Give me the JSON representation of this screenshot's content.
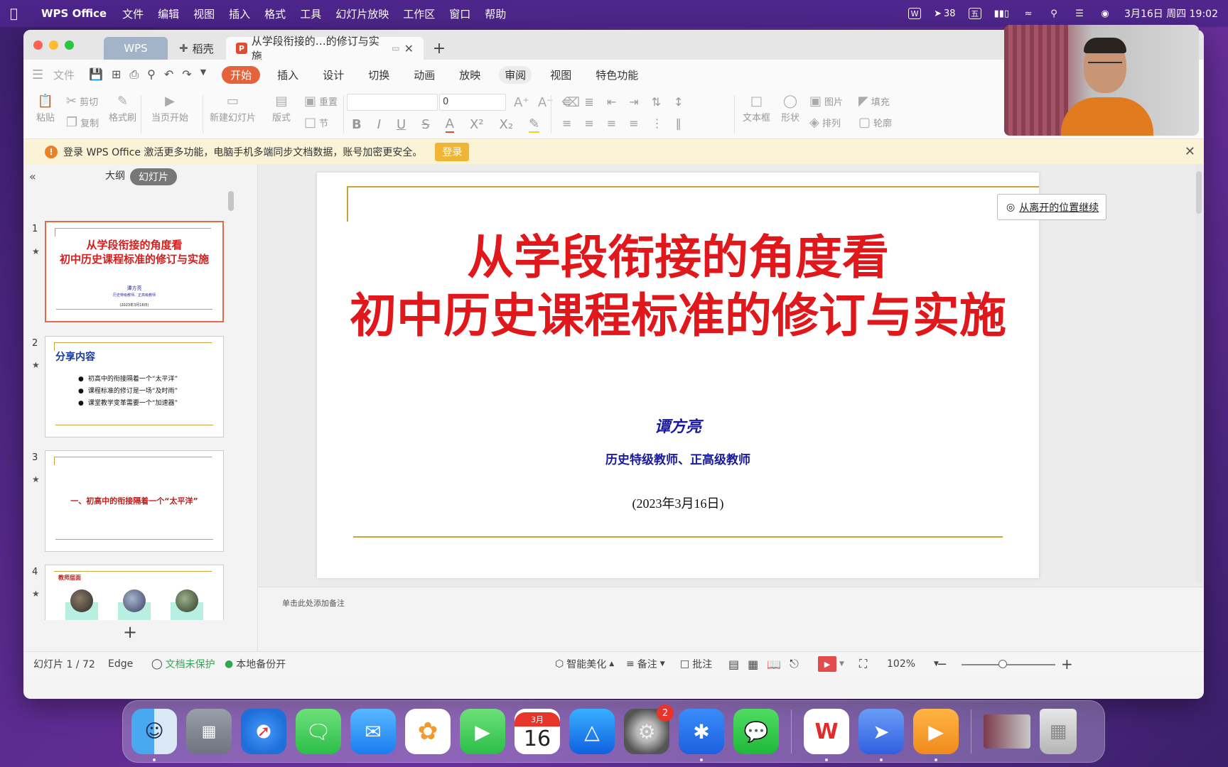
{
  "menubar": {
    "app_name": "WPS Office",
    "menus": [
      "文件",
      "编辑",
      "视图",
      "插入",
      "格式",
      "工具",
      "幻灯片放映",
      "工作区",
      "窗口",
      "帮助"
    ],
    "tray": {
      "notification_count": "38",
      "input_method": "五",
      "datetime": "3月16日 周四 19:02"
    }
  },
  "window": {
    "tabs": {
      "wps": "WPS",
      "daoke": "稻壳",
      "doc": "从学段衔接的…的修订与实施",
      "add": "+"
    },
    "ribbon_tabs": {
      "file": "文件",
      "home": "开始",
      "insert": "插入",
      "design": "设计",
      "transition": "切换",
      "animation": "动画",
      "show": "放映",
      "review": "审阅",
      "view": "视图",
      "special": "特色功能"
    },
    "toolbar": {
      "paste": "粘贴",
      "cut": "剪切",
      "copy": "复制",
      "format_painter": "格式刷",
      "from_current": "当页开始",
      "new_slide": "新建幻灯片",
      "layout": "版式",
      "reset": "重置",
      "section": "节",
      "font_size": "0",
      "textbox": "文本框",
      "shape": "形状",
      "picture": "图片",
      "arrange": "排列",
      "fill": "填充",
      "outline": "轮廓"
    },
    "notice": {
      "text": "登录 WPS Office 激活更多功能，电脑手机多端同步文档数据，账号加密更安全。",
      "login": "登录"
    },
    "left_panel": {
      "outline_tab": "大纲",
      "slides_tab": "幻灯片",
      "thumbs": [
        {
          "num": "1",
          "title_line1": "从学段衔接的角度看",
          "title_line2": "初中历史课程标准的修订与实施",
          "author": "谭方亮",
          "role": "历史特级教师、正高级教师",
          "date": "(2023年3月16日)"
        },
        {
          "num": "2",
          "title": "分享内容",
          "items": [
            "初高中的衔接隔着一个“太平洋”",
            "课程标准的修订是一场“及时雨”",
            "课堂教学变革需要一个“加速器”"
          ]
        },
        {
          "num": "3",
          "title": "一、初高中的衔接隔着一个“太平洋”"
        },
        {
          "num": "4",
          "title": "教师层面"
        }
      ]
    },
    "slide": {
      "title_line1": "从学段衔接的角度看",
      "title_line2": "初中历史课程标准的修订与实施",
      "author": "谭方亮",
      "role": "历史特级教师、正高级教师",
      "date": "(2023年3月16日)"
    },
    "continue_button": "从离开的位置继续",
    "notes_placeholder": "单击此处添加备注",
    "status": {
      "slide_counter": "幻灯片 1 / 72",
      "theme": "Edge",
      "protect": "文档未保护",
      "backup": "本地备份开",
      "beautify": "智能美化",
      "notes": "备注",
      "comment": "批注",
      "zoom": "102%"
    }
  },
  "dock": {
    "calendar_month": "3月",
    "calendar_day": "16",
    "settings_badge": "2",
    "icons": [
      "finder-icon",
      "launchpad-icon",
      "safari-icon",
      "messages-icon",
      "mail-icon",
      "photos-icon",
      "facetime-icon",
      "calendar-icon",
      "app-store-icon",
      "system-settings-icon",
      "tencent-meeting-icon",
      "wechat-icon",
      "wps-icon",
      "feishu-icon",
      "tv-icon",
      "window-preview-icon",
      "trash-icon"
    ]
  },
  "colors": {
    "accent": "#e5623a",
    "title_red": "#e0181c",
    "gold_line": "#c9a33a",
    "author_blue": "#1a1aa0"
  }
}
